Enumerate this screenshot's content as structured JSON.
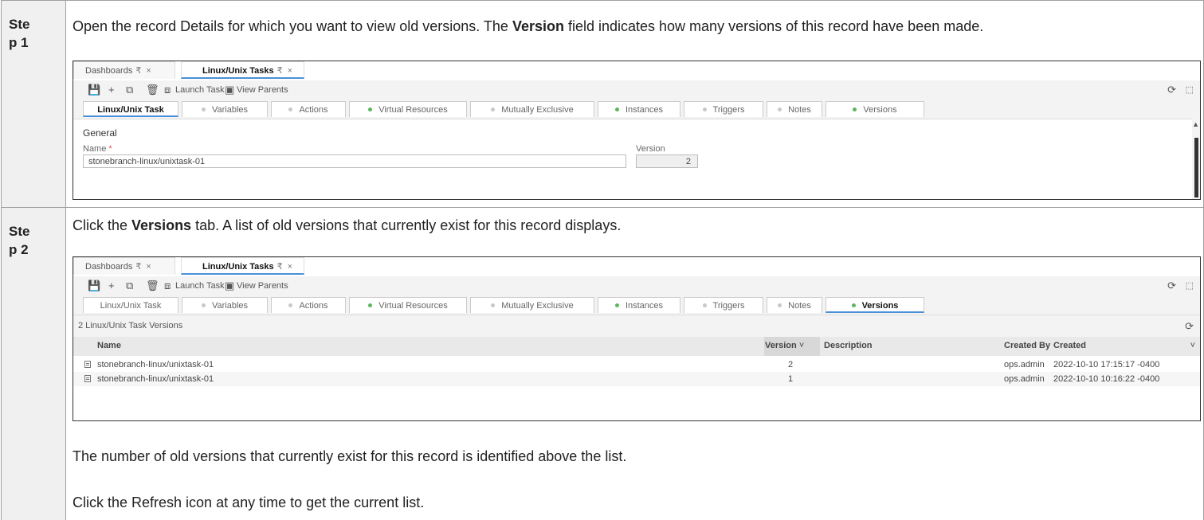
{
  "steps": [
    {
      "label": "Ste p 1",
      "label_line1": "Ste",
      "label_line2": "p 1",
      "text_before": "Open the record Details for which you want to view old versions. The ",
      "text_bold": "Version",
      "text_after": " field indicates how many versions of this record have been made."
    },
    {
      "label_line1": "Ste",
      "label_line2": "p 2",
      "text_before": "Click the ",
      "text_bold": "Versions",
      "text_after": " tab. A list of old versions that currently exist for this record displays.",
      "para1": "The number of old versions that currently exist for this record is identified above the list.",
      "para2": "Click the Refresh icon at any time to get the current list."
    }
  ],
  "app": {
    "doc_tabs": [
      {
        "label": "Dashboards",
        "pin": "₹",
        "close": "×"
      },
      {
        "label": "Linux/Unix Tasks",
        "pin": "₹",
        "close": "×"
      }
    ],
    "toolbar": {
      "launch_task": "Launch Task",
      "view_parents": "View Parents"
    },
    "sub_tabs": [
      {
        "label": "Linux/Unix Task",
        "dot": ""
      },
      {
        "label": "Variables",
        "dot": "grey"
      },
      {
        "label": "Actions",
        "dot": "grey"
      },
      {
        "label": "Virtual Resources",
        "dot": "green"
      },
      {
        "label": "Mutually Exclusive",
        "dot": "grey"
      },
      {
        "label": "Instances",
        "dot": "green"
      },
      {
        "label": "Triggers",
        "dot": "grey"
      },
      {
        "label": "Notes",
        "dot": "grey"
      },
      {
        "label": "Versions",
        "dot": "green"
      }
    ],
    "details": {
      "section": "General",
      "name_label": "Name",
      "required_mark": "*",
      "name_value": "stonebranch-linux/unixtask-01",
      "version_label": "Version",
      "version_value": "2"
    },
    "versions_list": {
      "title": "2 Linux/Unix Task Versions",
      "columns": [
        "Name",
        "Version",
        "Description",
        "Created By",
        "Created"
      ],
      "rows": [
        {
          "name": "stonebranch-linux/unixtask-01",
          "version": "2",
          "description": "",
          "created_by": "ops.admin",
          "created": "2022-10-10 17:15:17 -0400"
        },
        {
          "name": "stonebranch-linux/unixtask-01",
          "version": "1",
          "description": "",
          "created_by": "ops.admin",
          "created": "2022-10-10 10:16:22 -0400"
        }
      ]
    }
  },
  "colors": {
    "accent": "#4a90d9",
    "green_dot": "#5cb85c",
    "required": "#d9534f"
  }
}
